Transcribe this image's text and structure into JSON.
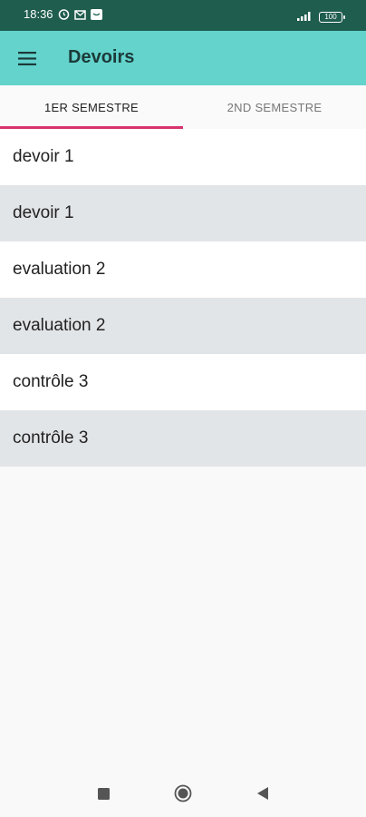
{
  "status_bar": {
    "time": "18:36",
    "icons_left": [
      "alarm-icon",
      "mail-icon",
      "message-icon"
    ],
    "icons_right": [
      "signal-icon",
      "battery-icon"
    ],
    "battery_level": "100"
  },
  "app_bar": {
    "title": "Devoirs",
    "background_color": "#63d3cc"
  },
  "tabs": [
    {
      "label": "1ER SEMESTRE",
      "active": true
    },
    {
      "label": "2ND SEMESTRE",
      "active": false
    }
  ],
  "accent_color": "#d8336c",
  "items": [
    {
      "label": "devoir 1"
    },
    {
      "label": "devoir 1"
    },
    {
      "label": "evaluation 2"
    },
    {
      "label": "evaluation 2"
    },
    {
      "label": "contrôle 3"
    },
    {
      "label": "contrôle 3"
    }
  ],
  "nav_bar": [
    "recents-button",
    "home-button",
    "back-button"
  ]
}
